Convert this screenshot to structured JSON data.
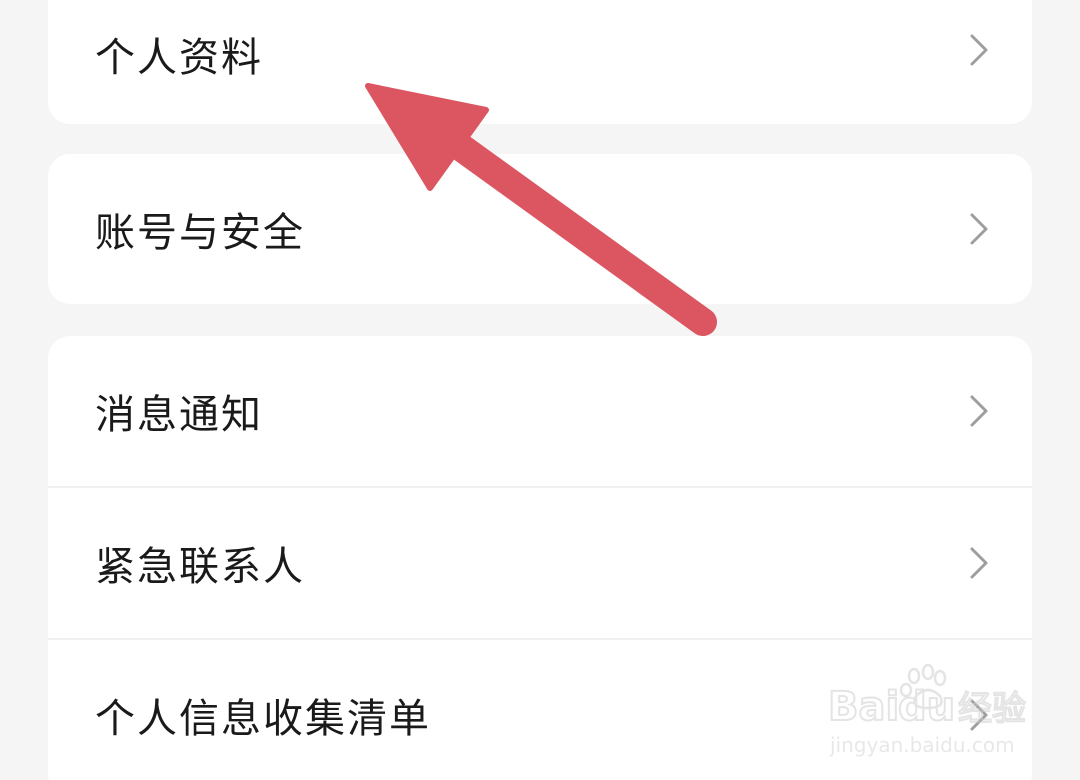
{
  "settings": {
    "cards": [
      {
        "items": [
          {
            "label": "个人资料",
            "chevron_icon": "chevron-right-icon"
          }
        ]
      },
      {
        "items": [
          {
            "label": "账号与安全",
            "chevron_icon": "chevron-right-icon"
          }
        ]
      },
      {
        "items": [
          {
            "label": "消息通知",
            "chevron_icon": "chevron-right-icon"
          },
          {
            "label": "紧急联系人",
            "chevron_icon": "chevron-right-icon"
          },
          {
            "label": "个人信息收集清单",
            "chevron_icon": "chevron-right-icon"
          }
        ]
      }
    ]
  },
  "annotation": {
    "icon": "arrow-pointer-icon",
    "color": "#dc5661"
  },
  "watermark": {
    "brand": "Bai",
    "brand_suffix": "du",
    "product": "经验",
    "url": "jingyan.baidu.com"
  },
  "colors": {
    "background": "#f5f5f5",
    "card": "#ffffff",
    "text": "#1a1a1a",
    "chevron": "#9e9e9e"
  }
}
